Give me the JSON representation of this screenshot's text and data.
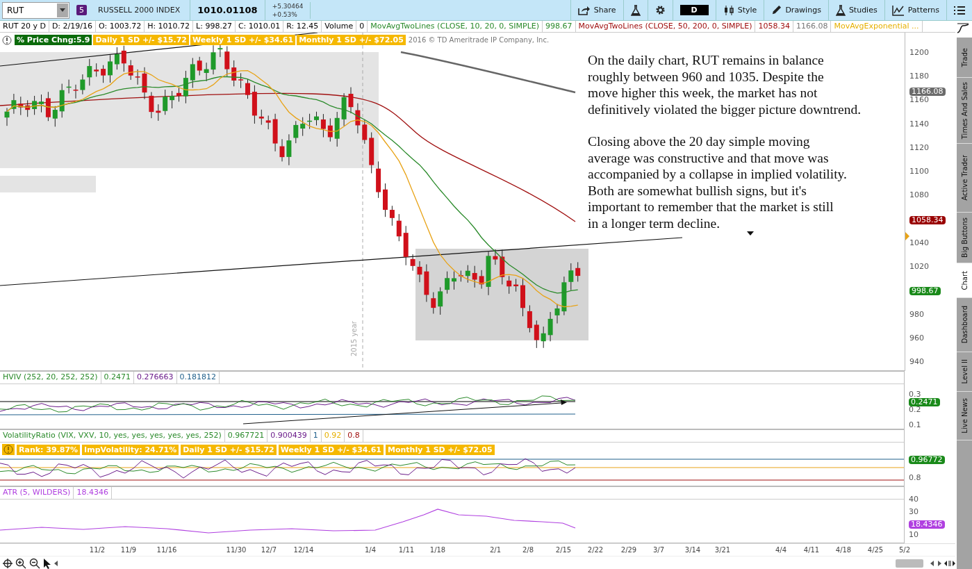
{
  "toolbar": {
    "symbol": "RUT",
    "link_group": "5",
    "instrument": "RUSSELL 2000 INDEX",
    "last": "1010.01108",
    "change": "+5.30464",
    "change_pct": "+0.53%",
    "buttons": [
      {
        "kind": "share",
        "label": "Share"
      },
      {
        "kind": "beaker"
      },
      {
        "kind": "gear"
      },
      {
        "kind": "aggregation",
        "label": "D"
      },
      {
        "kind": "style",
        "label": "Style"
      },
      {
        "kind": "drawings",
        "label": "Drawings"
      },
      {
        "kind": "studies",
        "label": "Studies"
      },
      {
        "kind": "patterns",
        "label": "Patterns"
      },
      {
        "kind": "menu"
      }
    ]
  },
  "legend": [
    {
      "text": "RUT 20 y D"
    },
    {
      "text": "D: 2/19/16"
    },
    {
      "text": "O: 1003.72"
    },
    {
      "text": "H: 1010.72"
    },
    {
      "text": "L: 998.27"
    },
    {
      "text": "C: 1010.01"
    },
    {
      "text": "R: 12.45"
    },
    {
      "text": "Volume"
    },
    {
      "text": "0"
    },
    {
      "text": "MovAvgTwoLines (CLOSE, 10, 20, 0, SIMPLE)",
      "color": "#2a8a2a"
    },
    {
      "text": "998.67",
      "color": "#2a8a2a"
    },
    {
      "text": "MovAvgTwoLines (CLOSE, 50, 200, 0, SIMPLE)",
      "color": "#a01010"
    },
    {
      "text": "1058.34",
      "color": "#a01010"
    },
    {
      "text": "1166.08",
      "color": "#777777"
    },
    {
      "text": "MovAvgExponential ...",
      "color": "#e6b000"
    }
  ],
  "badges": [
    {
      "text": "% Price Chng:5.9",
      "color": "#0b6b0b"
    },
    {
      "text": "Daily 1 SD +/- $15.72",
      "color": "#f5b800"
    },
    {
      "text": "Weekly 1 SD +/- $34.61",
      "color": "#f5b800"
    },
    {
      "text": "Monthly 1 SD +/- $72.05",
      "color": "#f5b800"
    }
  ],
  "copyright": "2016 © TD Ameritrade IP Company, Inc.",
  "annotation": [
    "On the daily chart, RUT remains in balance\nroughly between 960 and 1035.  Despite the\nmove higher this week, the market has not\ndefinitively violated the bigger picture downtrend.",
    "Closing above the 20 day simple moving\naverage was constructive and that move was\naccompanied by a collapse in implied volatility.\nBoth are somewhat bullish signs, but it's\nimportant to remember that the market is still\nin a longer term decline."
  ],
  "year_label": "2015 year",
  "price_axis": {
    "ticks": [
      "1200",
      "1180",
      "1160",
      "1140",
      "1120",
      "1100",
      "1080",
      "1040",
      "1020",
      "980",
      "960",
      "940"
    ],
    "markers": [
      {
        "text": "1166.08",
        "color": "#6b6b6b"
      },
      {
        "text": "1058.34",
        "color": "#990000"
      },
      {
        "text": "998.67",
        "color": "#1a8a1a"
      }
    ]
  },
  "studies": [
    {
      "kind": "hviv",
      "legend": [
        {
          "text": "HVIV (252, 20, 252, 252)",
          "color": "#2a8a2a"
        },
        {
          "text": "0.2471",
          "color": "#2a8a2a"
        },
        {
          "text": "0.276663",
          "color": "#6a1b8a"
        },
        {
          "text": "0.181812",
          "color": "#1f5f8b"
        }
      ],
      "ticks": [
        "0.3",
        "0.2",
        "0.1"
      ],
      "marker": {
        "text": "0.2471",
        "color": "#1a8a1a"
      }
    },
    {
      "kind": "volatility",
      "legend": [
        {
          "text": "VolatilityRatio (VIX, VXV, 10, yes, yes, yes, yes, yes, 252)",
          "color": "#2a8a2a"
        },
        {
          "text": "0.967721",
          "color": "#2a8a2a"
        },
        {
          "text": "0.900439",
          "color": "#6a1b8a"
        },
        {
          "text": "1",
          "color": "#1f5f8b"
        },
        {
          "text": "0.92",
          "color": "#e6b000"
        },
        {
          "text": "0.8",
          "color": "#a01010"
        }
      ],
      "badges": [
        {
          "text": "Rank: 39.87%",
          "color": "#f5b800"
        },
        {
          "text": "ImpVolatility: 24.71%",
          "color": "#f5b800"
        },
        {
          "text": "Daily 1 SD +/- $15.72",
          "color": "#f5b800"
        },
        {
          "text": "Weekly 1 SD +/- $34.61",
          "color": "#f5b800"
        },
        {
          "text": "Monthly 1 SD +/- $72.05",
          "color": "#f5b800"
        }
      ],
      "ticks": [
        "0.8"
      ],
      "marker": {
        "text": "0.96772",
        "color": "#1a8a1a"
      }
    },
    {
      "kind": "atr",
      "legend": [
        {
          "text": "ATR (5, WILDERS)",
          "color": "#b040e0"
        },
        {
          "text": "18.4346",
          "color": "#b040e0"
        }
      ],
      "ticks": [
        "40",
        "30",
        "10"
      ],
      "marker": {
        "text": "18.4346",
        "color": "#b040e0"
      }
    }
  ],
  "x_axis": [
    "11/2",
    "11/9",
    "11/16",
    "11/30",
    "12/7",
    "12/14",
    "1/4",
    "1/11",
    "1/18",
    "2/1",
    "2/8",
    "2/15",
    "2/22",
    "2/29",
    "3/7",
    "3/14",
    "3/21",
    "4/4",
    "4/11",
    "4/18",
    "4/25",
    "5/2"
  ],
  "side_tabs": [
    {
      "label": "Trade",
      "selected": false
    },
    {
      "label": "Times And Sales",
      "selected": false
    },
    {
      "label": "Active Trader",
      "selected": false
    },
    {
      "label": "Big Buttons",
      "selected": false
    },
    {
      "label": "Chart",
      "selected": true
    },
    {
      "label": "Dashboard",
      "selected": false
    },
    {
      "label": "Level II",
      "selected": false
    },
    {
      "label": "Live News",
      "selected": false
    }
  ]
}
